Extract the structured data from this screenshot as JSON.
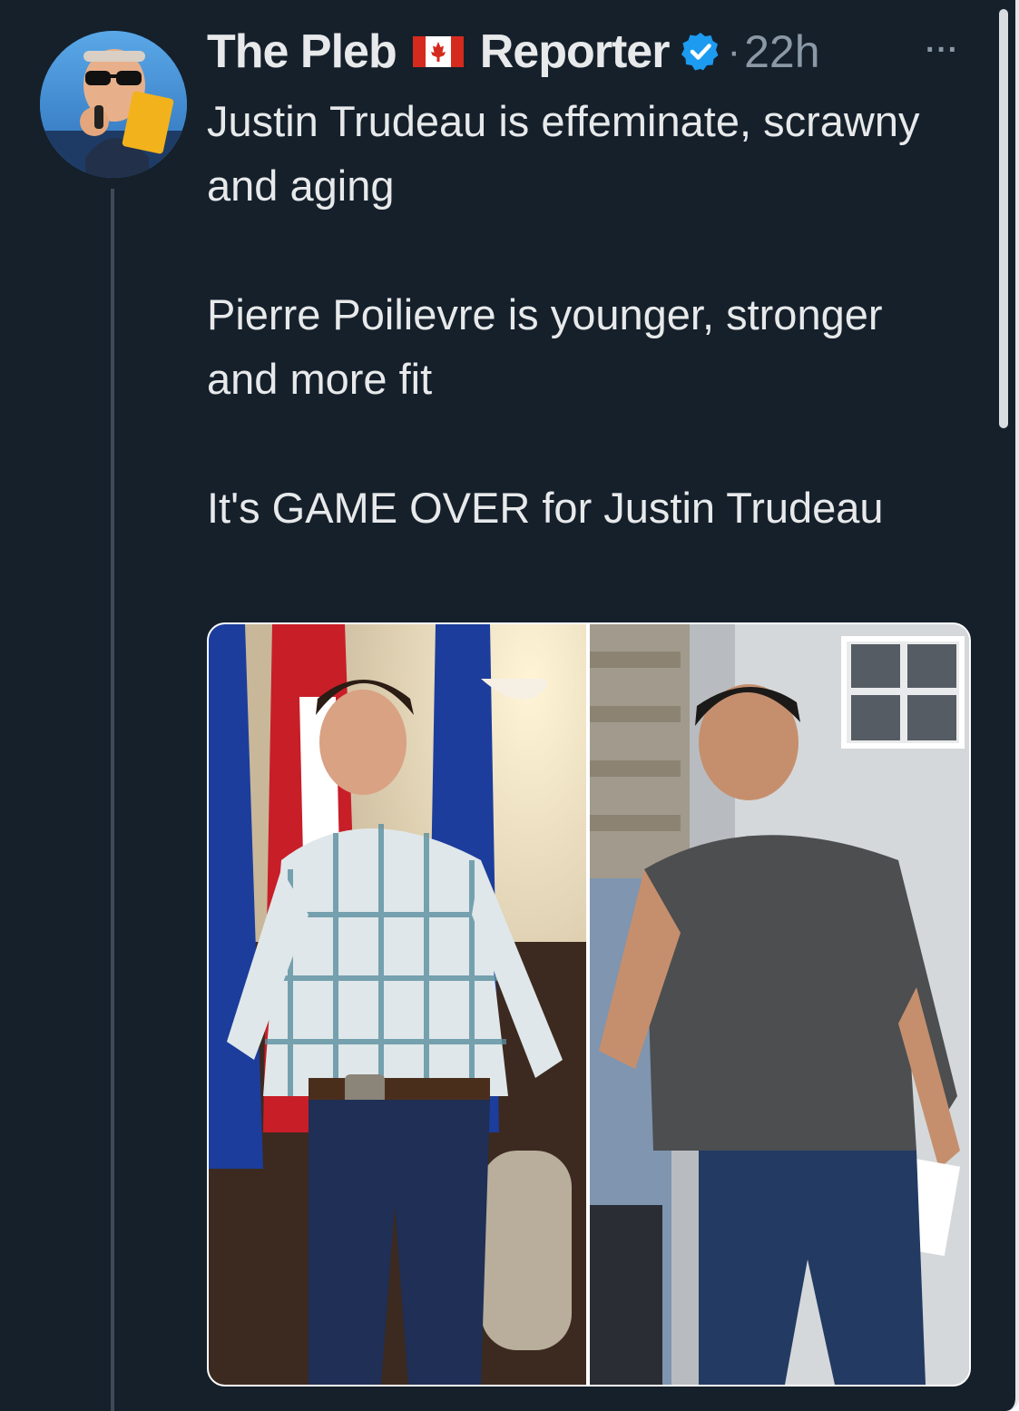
{
  "tweet": {
    "display_name_part1": "The Pleb",
    "display_name_part2": "Reporter",
    "flag_icon": "canada-flag-icon",
    "verified_icon": "verified-badge-icon",
    "separator": "·",
    "timestamp": "22h",
    "more_icon": "more-options-icon",
    "more_label": "···",
    "paragraphs": [
      "Justin Trudeau is effeminate, scrawny and aging",
      "Pierre Poilievre is younger, stronger and more fit",
      "It's GAME OVER for Justin Trudeau"
    ]
  },
  "colors": {
    "background": "#15202b",
    "text_primary": "#e7e9ea",
    "text_secondary": "#8b98a5",
    "verified_blue": "#1d9bf0",
    "canada_red": "#d52b1e"
  }
}
